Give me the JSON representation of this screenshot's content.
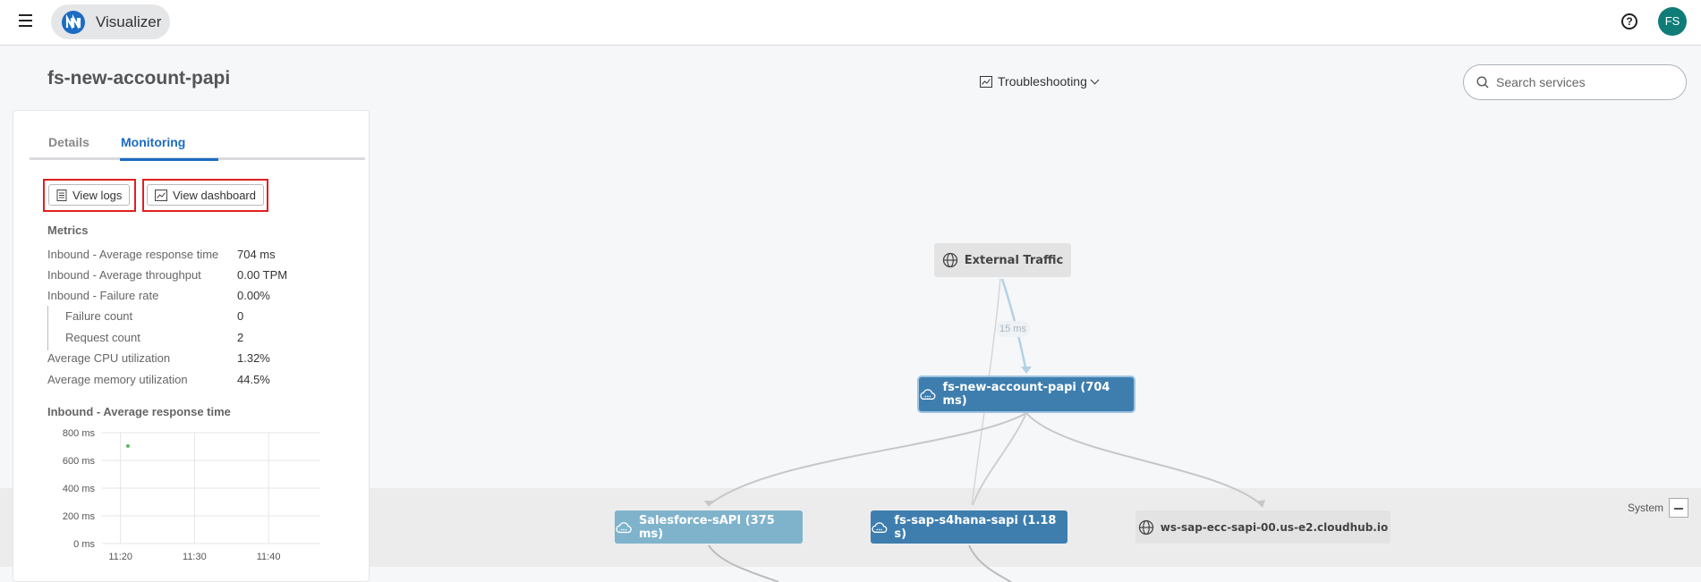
{
  "app": {
    "name": "Visualizer",
    "avatar_initials": "FS",
    "help_symbol": "?"
  },
  "page": {
    "title": "fs-new-account-papi"
  },
  "toolbar": {
    "mode_label": "Troubleshooting",
    "search_placeholder": "Search services",
    "search_value": ""
  },
  "panel": {
    "tabs": [
      {
        "label": "Details",
        "active": false
      },
      {
        "label": "Monitoring",
        "active": true
      }
    ],
    "buttons": {
      "view_logs": "View logs",
      "view_dashboard": "View dashboard"
    },
    "metrics_heading": "Metrics",
    "metrics": [
      {
        "label": "Inbound - Average response time",
        "value": "704 ms"
      },
      {
        "label": "Inbound - Average throughput",
        "value": "0.00 TPM"
      },
      {
        "label": "Inbound - Failure rate",
        "value": "0.00%"
      },
      {
        "label": "Failure count",
        "value": "0"
      },
      {
        "label": "Request count",
        "value": "2"
      },
      {
        "label": "Average CPU utilization",
        "value": "1.32%"
      },
      {
        "label": "Average memory utilization",
        "value": "44.5%"
      }
    ],
    "chart_heading": "Inbound - Average response time"
  },
  "chart_data": {
    "type": "scatter",
    "title": "Inbound - Average response time",
    "y_ticks": [
      "800 ms",
      "600 ms",
      "400 ms",
      "200 ms",
      "0 ms"
    ],
    "x_ticks": [
      "11:20",
      "11:30",
      "11:40"
    ],
    "ylim": [
      0,
      800
    ],
    "grid": true,
    "series": [
      {
        "points": [
          {
            "x": "11:21",
            "y": 704
          }
        ],
        "color": "#5cb85c"
      }
    ]
  },
  "graph": {
    "nodes": {
      "external": "External Traffic",
      "main": "fs-new-account-papi (704 ms)",
      "salesforce": "Salesforce-sAPI (375 ms)",
      "s4hana": "fs-sap-s4hana-sapi (1.18 s)",
      "ws": "ws-sap-ecc-sapi-00.us-e2.cloudhub.io"
    },
    "edge_label": "15 ms",
    "system_label": "System"
  },
  "colors": {
    "accent": "#1b6cc2",
    "node_primary": "#3e7eaf",
    "node_light": "#7fb3cc",
    "highlight": "#e02020",
    "avatar": "#0f7c78"
  }
}
